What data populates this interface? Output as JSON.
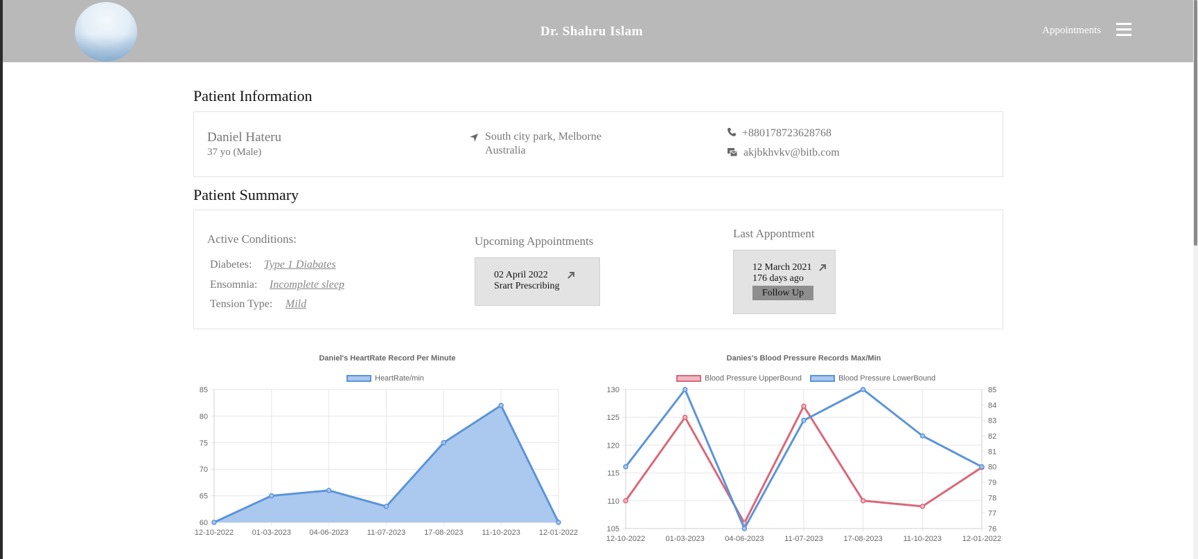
{
  "header": {
    "doctor_name": "Dr. Shahru Islam",
    "nav_link": "Appointments",
    "menu_icon": "hamburger-icon"
  },
  "patient_info": {
    "heading": "Patient Information",
    "name": "Daniel Hateru",
    "age_gender": "37 yo (Male)",
    "address_line1": "South city park, Melborne",
    "address_line2": "Australia",
    "phone": "+880178723628768",
    "email": "akjbkhvkv@bitb.com",
    "icons": [
      "location-arrow-icon",
      "phone-icon",
      "mail-icon"
    ]
  },
  "summary": {
    "heading": "Patient Summary",
    "active_conditions_label": "Active Conditions:",
    "conditions": [
      {
        "label": "Diabetes:",
        "value": "Type 1 Diabates"
      },
      {
        "label": "Ensomnia:",
        "value": "Incomplete sleep"
      },
      {
        "label": "Tension Type:",
        "value": "Mild"
      }
    ],
    "upcoming": {
      "heading": "Upcoming Appointments",
      "date": "02 April 2022",
      "note": "Srart Prescribing"
    },
    "last": {
      "heading": "Last Appontment",
      "date": "12 March 2021",
      "ago": "176 days ago",
      "button": "Follow Up"
    }
  },
  "chart_data": [
    {
      "type": "area",
      "title": "Daniel's HeartRate Record Per Minute",
      "categories": [
        "12-10-2022",
        "01-03-2023",
        "04-06-2023",
        "11-07-2023",
        "17-08-2023",
        "11-10-2023",
        "12-01-2022"
      ],
      "series": [
        {
          "name": "HeartRate/min",
          "values": [
            60,
            65,
            66,
            63,
            75,
            82,
            60
          ],
          "color": "#5b94d9",
          "fill": "#abc8ee"
        }
      ],
      "ylim": [
        60,
        85
      ],
      "yticks": [
        60,
        65,
        70,
        75,
        80,
        85
      ],
      "grid": true,
      "legend": "top"
    },
    {
      "type": "line",
      "title": "Danies's Blood Pressure Records Max/Min",
      "categories": [
        "12-10-2022",
        "01-03-2023",
        "04-06-2023",
        "11-07-2023",
        "17-08-2023",
        "11-10-2023",
        "12-01-2022"
      ],
      "series": [
        {
          "name": "Blood Pressure UpperBound",
          "axis": "left",
          "values": [
            110,
            125,
            106,
            127,
            110,
            109,
            116
          ],
          "color": "#d9687a",
          "fill": "#f1b8c2"
        },
        {
          "name": "Blood Pressure LowerBound",
          "axis": "right",
          "values": [
            80,
            85,
            76,
            83,
            85,
            82,
            80
          ],
          "color": "#5b94d9",
          "fill": "#abc8ee"
        }
      ],
      "ylim": [
        105,
        130
      ],
      "yticks": [
        105,
        110,
        115,
        120,
        125,
        130
      ],
      "y2lim": [
        76,
        85
      ],
      "y2ticks": [
        76,
        77,
        78,
        79,
        80,
        81,
        82,
        83,
        84,
        85
      ],
      "grid": true,
      "legend": "top"
    }
  ]
}
